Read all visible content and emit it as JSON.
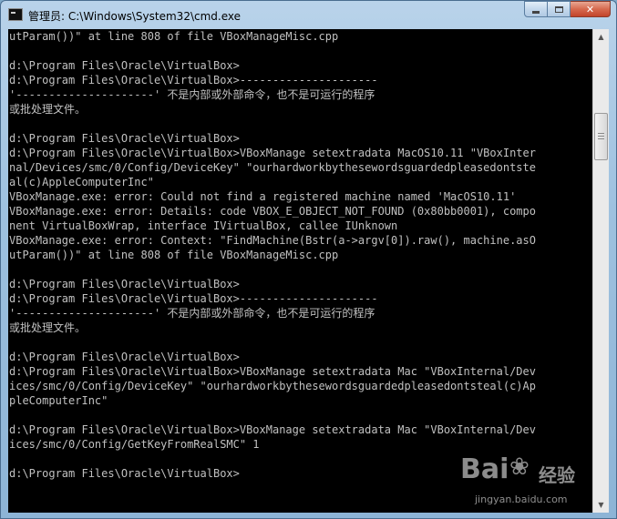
{
  "window": {
    "title": "管理员: C:\\Windows\\System32\\cmd.exe",
    "minimize_label": "minimize",
    "maximize_label": "maximize",
    "close_label": "✕"
  },
  "console": {
    "lines": [
      "utParam())\" at line 808 of file VBoxManageMisc.cpp",
      "",
      "d:\\Program Files\\Oracle\\VirtualBox>",
      "d:\\Program Files\\Oracle\\VirtualBox>---------------------",
      "'---------------------' 不是内部或外部命令，也不是可运行的程序",
      "或批处理文件。",
      "",
      "d:\\Program Files\\Oracle\\VirtualBox>",
      "d:\\Program Files\\Oracle\\VirtualBox>VBoxManage setextradata MacOS10.11 \"VBoxInter",
      "nal/Devices/smc/0/Config/DeviceKey\" \"ourhardworkbythesewordsguardedpleasedontste",
      "al(c)AppleComputerInc\"",
      "VBoxManage.exe: error: Could not find a registered machine named 'MacOS10.11'",
      "VBoxManage.exe: error: Details: code VBOX_E_OBJECT_NOT_FOUND (0x80bb0001), compo",
      "nent VirtualBoxWrap, interface IVirtualBox, callee IUnknown",
      "VBoxManage.exe: error: Context: \"FindMachine(Bstr(a->argv[0]).raw(), machine.asO",
      "utParam())\" at line 808 of file VBoxManageMisc.cpp",
      "",
      "d:\\Program Files\\Oracle\\VirtualBox>",
      "d:\\Program Files\\Oracle\\VirtualBox>---------------------",
      "'---------------------' 不是内部或外部命令，也不是可运行的程序",
      "或批处理文件。",
      "",
      "d:\\Program Files\\Oracle\\VirtualBox>",
      "d:\\Program Files\\Oracle\\VirtualBox>VBoxManage setextradata Mac \"VBoxInternal/Dev",
      "ices/smc/0/Config/DeviceKey\" \"ourhardworkbythesewordsguardedpleasedontsteal(c)Ap",
      "pleComputerInc\"",
      "",
      "d:\\Program Files\\Oracle\\VirtualBox>VBoxManage setextradata Mac \"VBoxInternal/Dev",
      "ices/smc/0/Config/GetKeyFromRealSMC\" 1",
      "",
      "d:\\Program Files\\Oracle\\VirtualBox>"
    ]
  },
  "scrollbar": {
    "up_icon": "scroll-up-arrow",
    "down_icon": "scroll-down-arrow"
  },
  "watermark": {
    "brand": "Bai",
    "brand_suffix": "经验",
    "url": "jingyan.baidu.com"
  }
}
